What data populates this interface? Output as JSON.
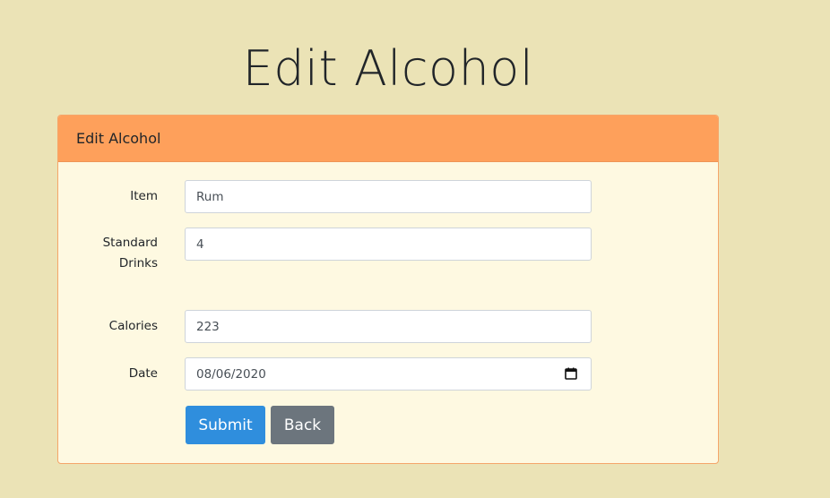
{
  "page": {
    "title": "Edit Alcohol"
  },
  "card": {
    "header": "Edit Alcohol"
  },
  "form": {
    "item_label": "Item",
    "item_value": "Rum",
    "drinks_label_line1": "Standard",
    "drinks_label_line2": "Drinks",
    "drinks_value": "4",
    "calories_label": "Calories",
    "calories_value": "223",
    "date_label": "Date",
    "date_value": "08/06/2020",
    "submit_label": "Submit",
    "back_label": "Back"
  },
  "colors": {
    "background": "#ebe3b6",
    "card_header": "#fea05b",
    "card_body": "#fef9e1",
    "submit": "#2f8edd",
    "back": "#6c757d"
  }
}
